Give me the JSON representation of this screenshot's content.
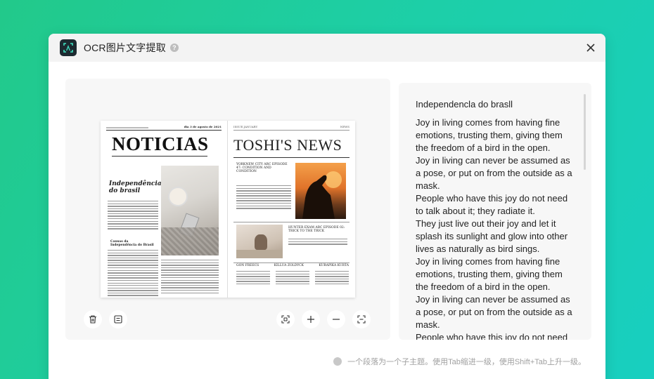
{
  "window": {
    "title": "OCR图片文字提取",
    "icons": {
      "app": "ocr-app-icon",
      "help": "help-icon",
      "close": "close-icon"
    }
  },
  "newspaper": {
    "left_page": {
      "top_line": "dia 3 de agosto de 2021",
      "masthead": "NOTICIAS",
      "headline": "Independência do brasil",
      "subhead": "Causas da Independência do Brasil"
    },
    "right_page": {
      "top_left": "ISSUE.JANUARY",
      "top_right": "NEWS",
      "masthead": "TOSHI'S NEWS",
      "article1_title": "YORKNEW CITY ARC EPISODE 47: CONDITION AND CONDITION",
      "article2_title": "HUNTER EXAM ARC EPISODE 02: TRICK TO THE TRICK",
      "col1": "GON FREECS",
      "col2": "KILLUA ZOLDYCK",
      "col3": "KURAPIKA KURTA"
    }
  },
  "toolbar": {
    "delete_icon": "trash-icon",
    "format_icon": "text-format-icon",
    "fit_icon": "fit-screen-icon",
    "zoom_in_icon": "plus-icon",
    "zoom_out_icon": "minus-icon",
    "actual_size_icon": "actual-size-icon"
  },
  "ocr_result": {
    "heading": "Independencla do brasll",
    "lines": [
      "Joy in living comes from having fine emotions, trusting them, giving them the freedom of a bird in the open.",
      "Joy in living can never be assumed as a pose, or put on from the outside as a mask.",
      "People who have this joy do not need to talk about it; they radiate it.",
      "They just live out their joy and let it splash its sunlight and glow into other lives as naturally as bird sings.",
      "Joy in living comes from having fine emotions, trusting them, giving them the freedom of a bird in the open.",
      "Joy in living can never be assumed as a pose, or put on from the outside as a mask.",
      "People who have this joy do not need to"
    ]
  },
  "hint": "一个段落为一个子主题。使用Tab缩进一级，使用Shift+Tab上升一级。"
}
